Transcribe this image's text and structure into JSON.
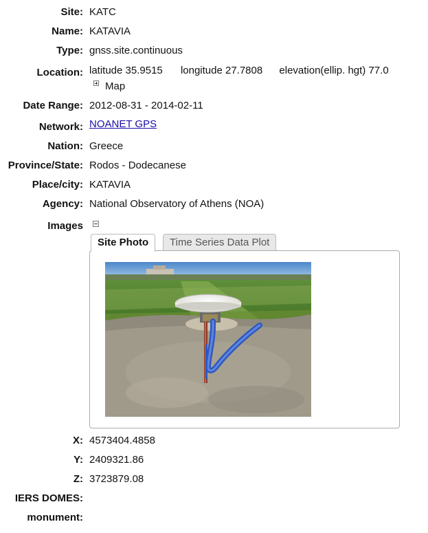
{
  "fields": {
    "site": {
      "label": "Site:",
      "value": "KATC"
    },
    "name": {
      "label": "Name:",
      "value": "KATAVIA"
    },
    "type": {
      "label": "Type:",
      "value": "gnss.site.continuous"
    },
    "location": {
      "label": "Location:",
      "latitude": "latitude 35.9515",
      "longitude": "longitude 27.7808",
      "elevation": "elevation(ellip. hgt) 77.0",
      "map_label": "Map"
    },
    "date_range": {
      "label": "Date Range:",
      "value": "2012-08-31 - 2014-02-11"
    },
    "network": {
      "label": "Network:",
      "value": "NOANET GPS"
    },
    "nation": {
      "label": "Nation:",
      "value": "Greece"
    },
    "province": {
      "label": "Province/State:",
      "value": "Rodos - Dodecanese"
    },
    "place": {
      "label": "Place/city:",
      "value": "KATAVIA"
    },
    "agency": {
      "label": "Agency:",
      "value": "National Observatory of Athens (NOA)"
    },
    "images": {
      "label": "Images"
    },
    "x": {
      "label": "X:",
      "value": "4573404.4858"
    },
    "y": {
      "label": "Y:",
      "value": "2409321.86"
    },
    "z": {
      "label": "Z:",
      "value": "3723879.08"
    },
    "iers_domes": {
      "label": "IERS DOMES:",
      "value": ""
    },
    "monument": {
      "label": "monument:",
      "value": ""
    }
  },
  "tabs": [
    {
      "label": "Site Photo",
      "active": true
    },
    {
      "label": "Time Series Data Plot",
      "active": false
    }
  ],
  "colors": {
    "link": "#1a0dab",
    "tab_inactive_bg": "#e8e8e8",
    "panel_border": "#aaaaaa"
  }
}
